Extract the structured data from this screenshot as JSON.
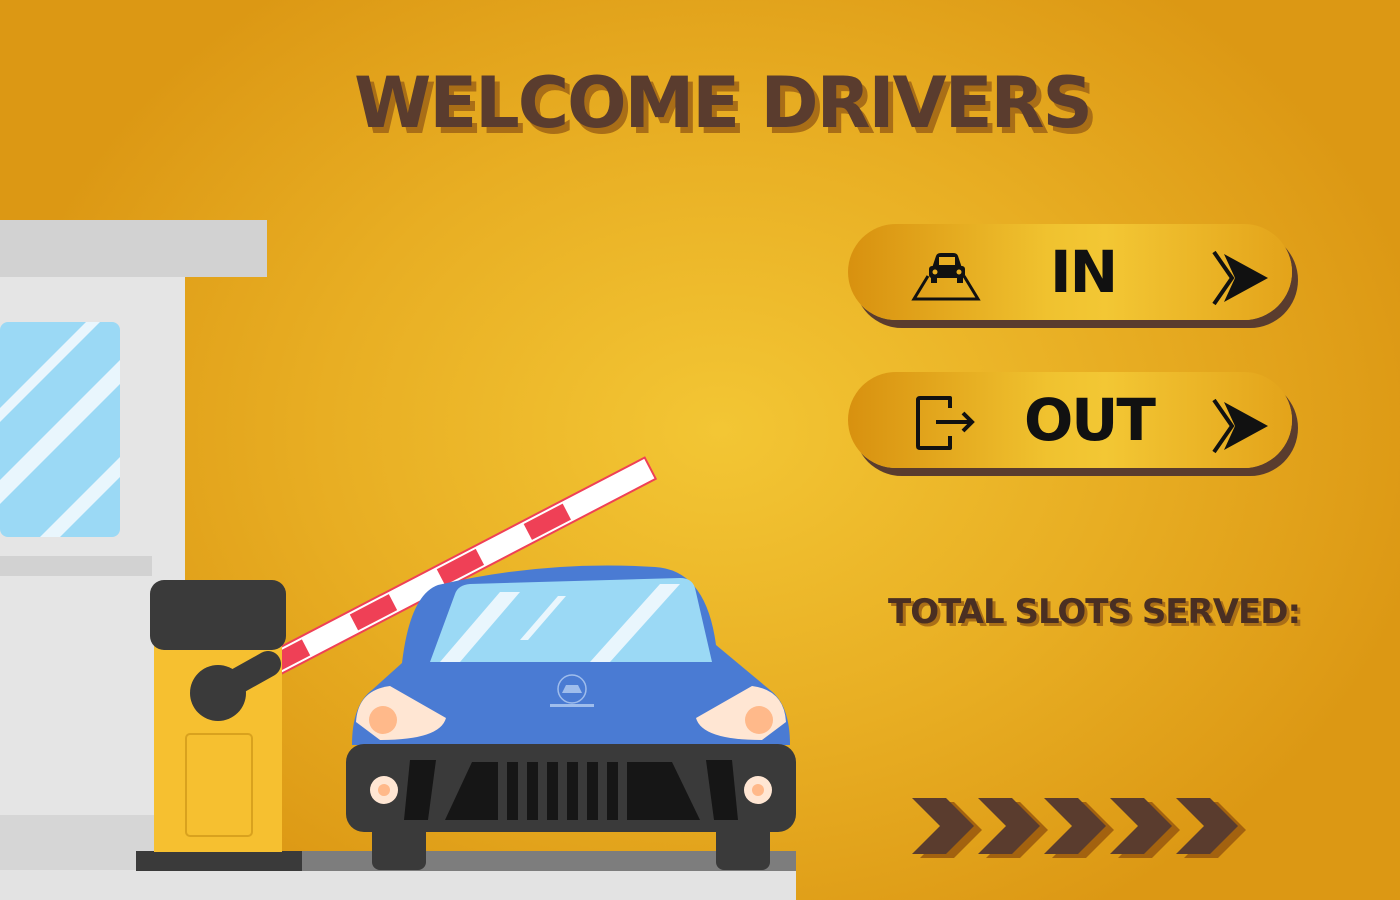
{
  "header": {
    "title": "WELCOME DRIVERS"
  },
  "actions": {
    "in": {
      "label": "IN",
      "icon": "car-on-road-icon",
      "arrow": "play-arrow-icon"
    },
    "out": {
      "label": "OUT",
      "icon": "exit-door-icon",
      "arrow": "play-arrow-icon"
    }
  },
  "stats": {
    "served_label": "TOTAL SLOTS SERVED:"
  },
  "decor": {
    "chevrons": "chevron-right-icon",
    "car_badge": "car-logo"
  },
  "colors": {
    "background": "#f3c634",
    "title": "#5a3c2e",
    "button_shadow": "#5a3c2e",
    "car": "#4a7bd3",
    "barrier_red": "#ef4056"
  }
}
